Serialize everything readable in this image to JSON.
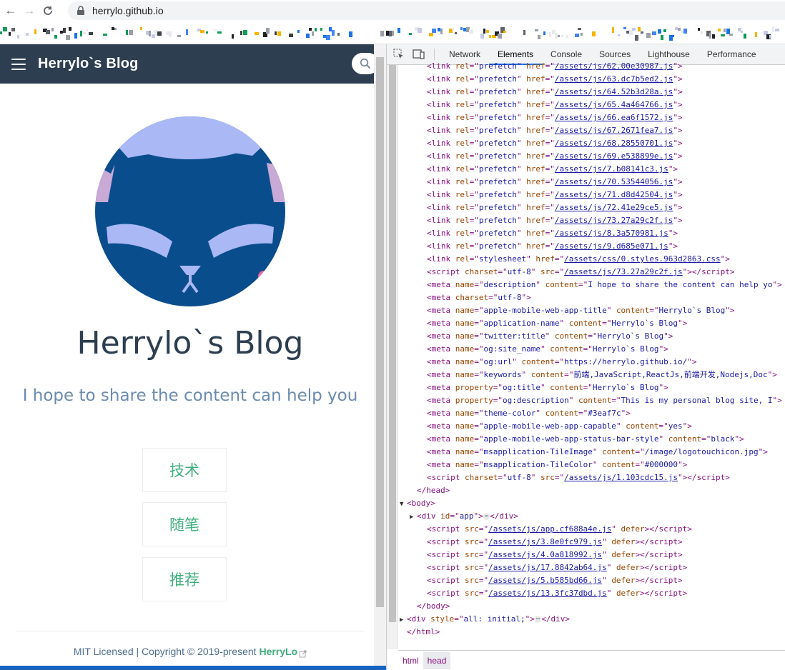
{
  "browser": {
    "url": "herrylo.github.io"
  },
  "site": {
    "title": "Herrylo`s Blog",
    "hero_title": "Herrylo`s Blog",
    "hero_desc": "I hope to share the content can help you",
    "features": [
      "技术",
      "随笔",
      "推荐"
    ],
    "footer_prefix": "MIT Licensed | Copyright © 2019-present ",
    "footer_link": "HerryLo",
    "colors": {
      "navbar": "#2c3e50",
      "accent": "#3eaf7c",
      "avatar_blue": "#0a4d8c",
      "avatar_ears": "#aab8f5"
    }
  },
  "devtools": {
    "tabs": [
      "Network",
      "Elements",
      "Console",
      "Sources",
      "Lighthouse",
      "Performance"
    ],
    "active_tab": "Elements",
    "breadcrumbs": [
      "html",
      "head"
    ],
    "dom_lines": [
      {
        "indent": 2,
        "kind": "link",
        "attr": "rel",
        "attrval": "prefetch",
        "attr2": "href",
        "href": "/assets/js/62.00e30987.js"
      },
      {
        "indent": 2,
        "kind": "link",
        "attr": "rel",
        "attrval": "prefetch",
        "attr2": "href",
        "href": "/assets/js/63.dc7b5ed2.js"
      },
      {
        "indent": 2,
        "kind": "link",
        "attr": "rel",
        "attrval": "prefetch",
        "attr2": "href",
        "href": "/assets/js/64.52b3d28a.js"
      },
      {
        "indent": 2,
        "kind": "link",
        "attr": "rel",
        "attrval": "prefetch",
        "attr2": "href",
        "href": "/assets/js/65.4a464766.js"
      },
      {
        "indent": 2,
        "kind": "link",
        "attr": "rel",
        "attrval": "prefetch",
        "attr2": "href",
        "href": "/assets/js/66.ea6f1572.js"
      },
      {
        "indent": 2,
        "kind": "link",
        "attr": "rel",
        "attrval": "prefetch",
        "attr2": "href",
        "href": "/assets/js/67.2671fea7.js"
      },
      {
        "indent": 2,
        "kind": "link",
        "attr": "rel",
        "attrval": "prefetch",
        "attr2": "href",
        "href": "/assets/js/68.28550701.js"
      },
      {
        "indent": 2,
        "kind": "link",
        "attr": "rel",
        "attrval": "prefetch",
        "attr2": "href",
        "href": "/assets/js/69.e538899e.js"
      },
      {
        "indent": 2,
        "kind": "link",
        "attr": "rel",
        "attrval": "prefetch",
        "attr2": "href",
        "href": "/assets/js/7.b08141c3.js"
      },
      {
        "indent": 2,
        "kind": "link",
        "attr": "rel",
        "attrval": "prefetch",
        "attr2": "href",
        "href": "/assets/js/70.53544056.js"
      },
      {
        "indent": 2,
        "kind": "link",
        "attr": "rel",
        "attrval": "prefetch",
        "attr2": "href",
        "href": "/assets/js/71.d8d42504.js"
      },
      {
        "indent": 2,
        "kind": "link",
        "attr": "rel",
        "attrval": "prefetch",
        "attr2": "href",
        "href": "/assets/js/72.41e29ce5.js"
      },
      {
        "indent": 2,
        "kind": "link",
        "attr": "rel",
        "attrval": "prefetch",
        "attr2": "href",
        "href": "/assets/js/73.27a29c2f.js"
      },
      {
        "indent": 2,
        "kind": "link",
        "attr": "rel",
        "attrval": "prefetch",
        "attr2": "href",
        "href": "/assets/js/8.3a570981.js"
      },
      {
        "indent": 2,
        "kind": "link",
        "attr": "rel",
        "attrval": "prefetch",
        "attr2": "href",
        "href": "/assets/js/9.d685e071.js"
      },
      {
        "indent": 2,
        "kind": "link",
        "attr": "rel",
        "attrval": "stylesheet",
        "attr2": "href",
        "href": "/assets/css/0.styles.963d2863.css"
      },
      {
        "indent": 2,
        "kind": "script",
        "attr": "charset",
        "attrval": "utf-8",
        "attr2": "src",
        "href": "/assets/js/73.27a29c2f.js"
      },
      {
        "indent": 2,
        "kind": "meta",
        "pairs": [
          [
            "name",
            "description"
          ],
          [
            "content",
            "I hope to share the content can help yo"
          ]
        ]
      },
      {
        "indent": 2,
        "kind": "meta",
        "pairs": [
          [
            "charset",
            "utf-8"
          ]
        ]
      },
      {
        "indent": 2,
        "kind": "meta",
        "pairs": [
          [
            "name",
            "apple-mobile-web-app-title"
          ],
          [
            "content",
            "Herrylo`s Blog"
          ]
        ]
      },
      {
        "indent": 2,
        "kind": "meta",
        "pairs": [
          [
            "name",
            "application-name"
          ],
          [
            "content",
            "Herrylo`s Blog"
          ]
        ]
      },
      {
        "indent": 2,
        "kind": "meta",
        "pairs": [
          [
            "name",
            "twitter:title"
          ],
          [
            "content",
            "Herrylo`s Blog"
          ]
        ]
      },
      {
        "indent": 2,
        "kind": "meta",
        "pairs": [
          [
            "name",
            "og:site_name"
          ],
          [
            "content",
            "Herrylo`s Blog"
          ]
        ]
      },
      {
        "indent": 2,
        "kind": "meta",
        "pairs": [
          [
            "name",
            "og:url"
          ],
          [
            "content",
            "https://herrylo.github.io/"
          ]
        ]
      },
      {
        "indent": 2,
        "kind": "meta",
        "pairs": [
          [
            "name",
            "keywords"
          ],
          [
            "content",
            "前端,JavaScript,ReactJs,前端开发,Nodejs,Doc"
          ]
        ]
      },
      {
        "indent": 2,
        "kind": "meta",
        "pairs": [
          [
            "property",
            "og:title"
          ],
          [
            "content",
            "Herrylo`s Blog"
          ]
        ]
      },
      {
        "indent": 2,
        "kind": "meta",
        "pairs": [
          [
            "property",
            "og:description"
          ],
          [
            "content",
            "This is my personal blog site, I"
          ]
        ]
      },
      {
        "indent": 2,
        "kind": "meta",
        "pairs": [
          [
            "name",
            "theme-color"
          ],
          [
            "content",
            "#3eaf7c"
          ]
        ]
      },
      {
        "indent": 2,
        "kind": "meta",
        "pairs": [
          [
            "name",
            "apple-mobile-web-app-capable"
          ],
          [
            "content",
            "yes"
          ]
        ]
      },
      {
        "indent": 2,
        "kind": "meta",
        "pairs": [
          [
            "name",
            "apple-mobile-web-app-status-bar-style"
          ],
          [
            "content",
            "black"
          ]
        ]
      },
      {
        "indent": 2,
        "kind": "meta",
        "pairs": [
          [
            "name",
            "msapplication-TileImage"
          ],
          [
            "content",
            "/image/logotouchicon.jpg"
          ]
        ]
      },
      {
        "indent": 2,
        "kind": "meta",
        "pairs": [
          [
            "name",
            "msapplication-TileColor"
          ],
          [
            "content",
            "#000000"
          ]
        ]
      },
      {
        "indent": 2,
        "kind": "script",
        "attr": "charset",
        "attrval": "utf-8",
        "attr2": "src",
        "href": "/assets/js/1.103cdc15.js"
      },
      {
        "indent": 1,
        "kind": "close",
        "tag": "head"
      },
      {
        "indent": 0,
        "kind": "open",
        "tag": "body",
        "tri": "▼"
      },
      {
        "indent": 1,
        "kind": "divapp",
        "tri": "▶"
      },
      {
        "indent": 2,
        "kind": "deferscript",
        "href": "/assets/js/app.cf688a4e.js"
      },
      {
        "indent": 2,
        "kind": "deferscript",
        "href": "/assets/js/3.8e0fc979.js"
      },
      {
        "indent": 2,
        "kind": "deferscript",
        "href": "/assets/js/4.0a818992.js"
      },
      {
        "indent": 2,
        "kind": "deferscript",
        "href": "/assets/js/17.8842ab64.js"
      },
      {
        "indent": 2,
        "kind": "deferscript",
        "href": "/assets/js/5.b585bd66.js"
      },
      {
        "indent": 2,
        "kind": "deferscript",
        "href": "/assets/js/13.3fc37dbd.js"
      },
      {
        "indent": 1,
        "kind": "close",
        "tag": "body"
      },
      {
        "indent": 0,
        "kind": "divstyle",
        "tri": "▶"
      },
      {
        "indent": 0,
        "kind": "close",
        "tag": "html"
      }
    ]
  }
}
